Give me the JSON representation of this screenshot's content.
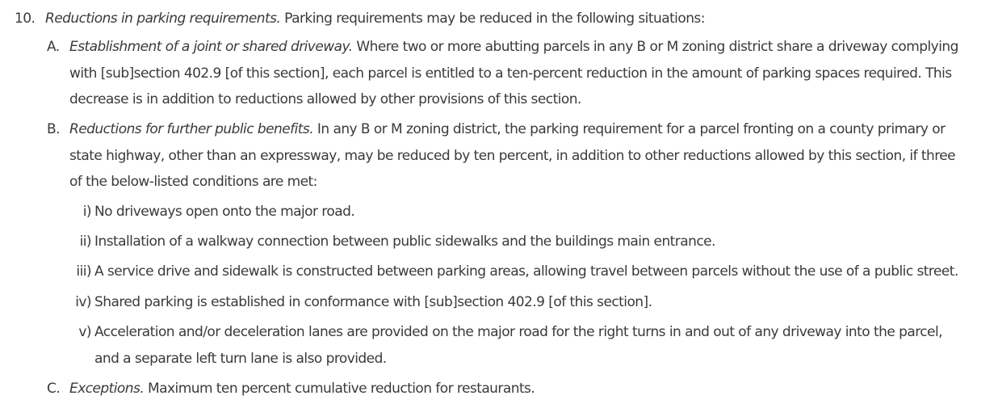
{
  "item": {
    "number": "10.",
    "title": "Reductions in parking requirements.",
    "text": " Parking requirements may be reduced in the following situations:"
  },
  "subitems": [
    {
      "marker": "A.",
      "title": "Establishment of a joint or shared driveway.",
      "lines": [
        " Where two or more abutting parcels in any B or M zoning district share a driveway complying",
        "with [sub]section 402.9 [of this section], each parcel is entitled to a ten-percent reduction in the amount of parking spaces required. This",
        "decrease is in addition to reductions allowed by other provisions of this section."
      ]
    },
    {
      "marker": "B.",
      "title": "Reductions for further public benefits.",
      "lines": [
        " In any B or M zoning district, the parking requirement for a parcel fronting on a county primary or",
        "state highway, other than an expressway, may be reduced by ten percent, in addition to other reductions allowed by this section, if three",
        "of the below-listed conditions are met:"
      ]
    },
    {
      "marker": "C.",
      "title": "Exceptions.",
      "lines": [
        " Maximum ten percent cumulative reduction for restaurants."
      ]
    }
  ],
  "conditions": [
    {
      "marker": "i)",
      "lines": [
        "No driveways open onto the major road."
      ]
    },
    {
      "marker": "ii)",
      "lines": [
        "Installation of a walkway connection between public sidewalks and the buildings main entrance."
      ]
    },
    {
      "marker": "iii)",
      "lines": [
        "A service drive and sidewalk is constructed between parking areas, allowing travel between parcels without the use of a public street."
      ]
    },
    {
      "marker": "iv)",
      "lines": [
        "Shared parking is established in conformance with [sub]section 402.9 [of this section]."
      ]
    },
    {
      "marker": "v)",
      "lines": [
        "Acceleration and/or deceleration lanes are provided on the major road for the right turns in and out of any driveway into the parcel,",
        "and a separate left turn lane is also provided."
      ]
    }
  ]
}
